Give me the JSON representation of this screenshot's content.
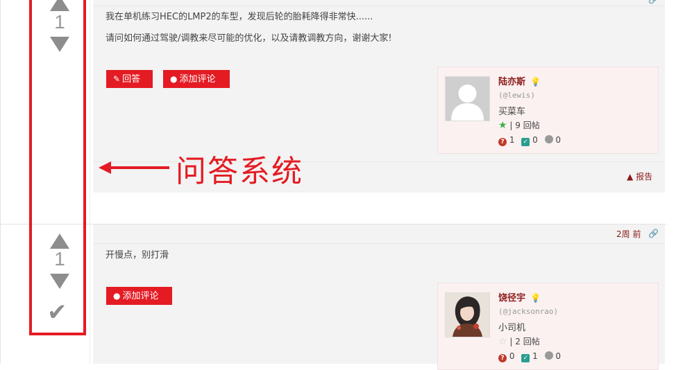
{
  "post1": {
    "vote_count": "1",
    "paragraph1": "我在单机练习HEC的LMP2的车型，发现后轮的胎耗降得非常快......",
    "paragraph2": "请问如何通过驾驶/调教来尽可能的优化，以及请教调教方向，谢谢大家!",
    "answer_button": "回答",
    "comment_button": "添加评论",
    "report_label": "报告",
    "user": {
      "name": "陆亦斯",
      "handle": "(@lewis)",
      "level": "买菜车",
      "posts": "| 9 回帖",
      "questions": "1",
      "answers": "0",
      "comments": "0"
    }
  },
  "post2": {
    "vote_count": "1",
    "text": "开慢点，别打滑",
    "time": "2周 前",
    "comment_button": "添加评论",
    "user": {
      "name": "饶径宇",
      "handle": "(@jacksonrao)",
      "level": "小司机",
      "posts": "| 2 回帖",
      "questions": "0",
      "answers": "1",
      "comments": "0"
    }
  },
  "annotation": {
    "label": "问答系统"
  },
  "colors": {
    "accent_red": "#e41b23",
    "username": "#8b1a1a",
    "vote_gray": "#8d8d8d",
    "panel_bg": "#f3f3f3",
    "card_bg": "#fbf1f1"
  }
}
